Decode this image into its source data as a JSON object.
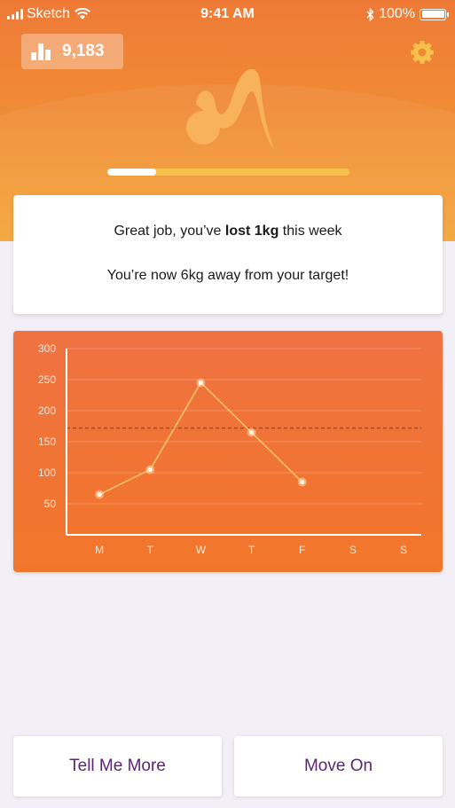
{
  "status_bar": {
    "carrier": "Sketch",
    "time": "9:41 AM",
    "battery": "100%"
  },
  "header": {
    "points": "9,183",
    "points_icon": "bar-chart-icon",
    "settings_icon": "gear-icon",
    "logo_icon": "brand-logo-icon",
    "progress": 0.2
  },
  "message": {
    "prefix": "Great job, you’ve ",
    "emphasis": "lost 1kg",
    "suffix": " this week",
    "line2": "You’re now 6kg away from your target!"
  },
  "chart_data": {
    "type": "line",
    "categories": [
      "M",
      "T",
      "W",
      "T",
      "F",
      "S",
      "S"
    ],
    "values": [
      65,
      105,
      245,
      165,
      85,
      null,
      null
    ],
    "ylim": [
      0,
      300
    ],
    "yticks": [
      "50",
      "100",
      "150",
      "200",
      "250",
      "300"
    ],
    "target": 172,
    "grid": true,
    "title": "",
    "xlabel": "",
    "ylabel": ""
  },
  "buttons": {
    "tell_me_more": "Tell Me More",
    "move_on": "Move On"
  },
  "colors": {
    "accent": "#f08b35",
    "chart_bg": "#f2762a",
    "button_text": "#5b2476"
  }
}
